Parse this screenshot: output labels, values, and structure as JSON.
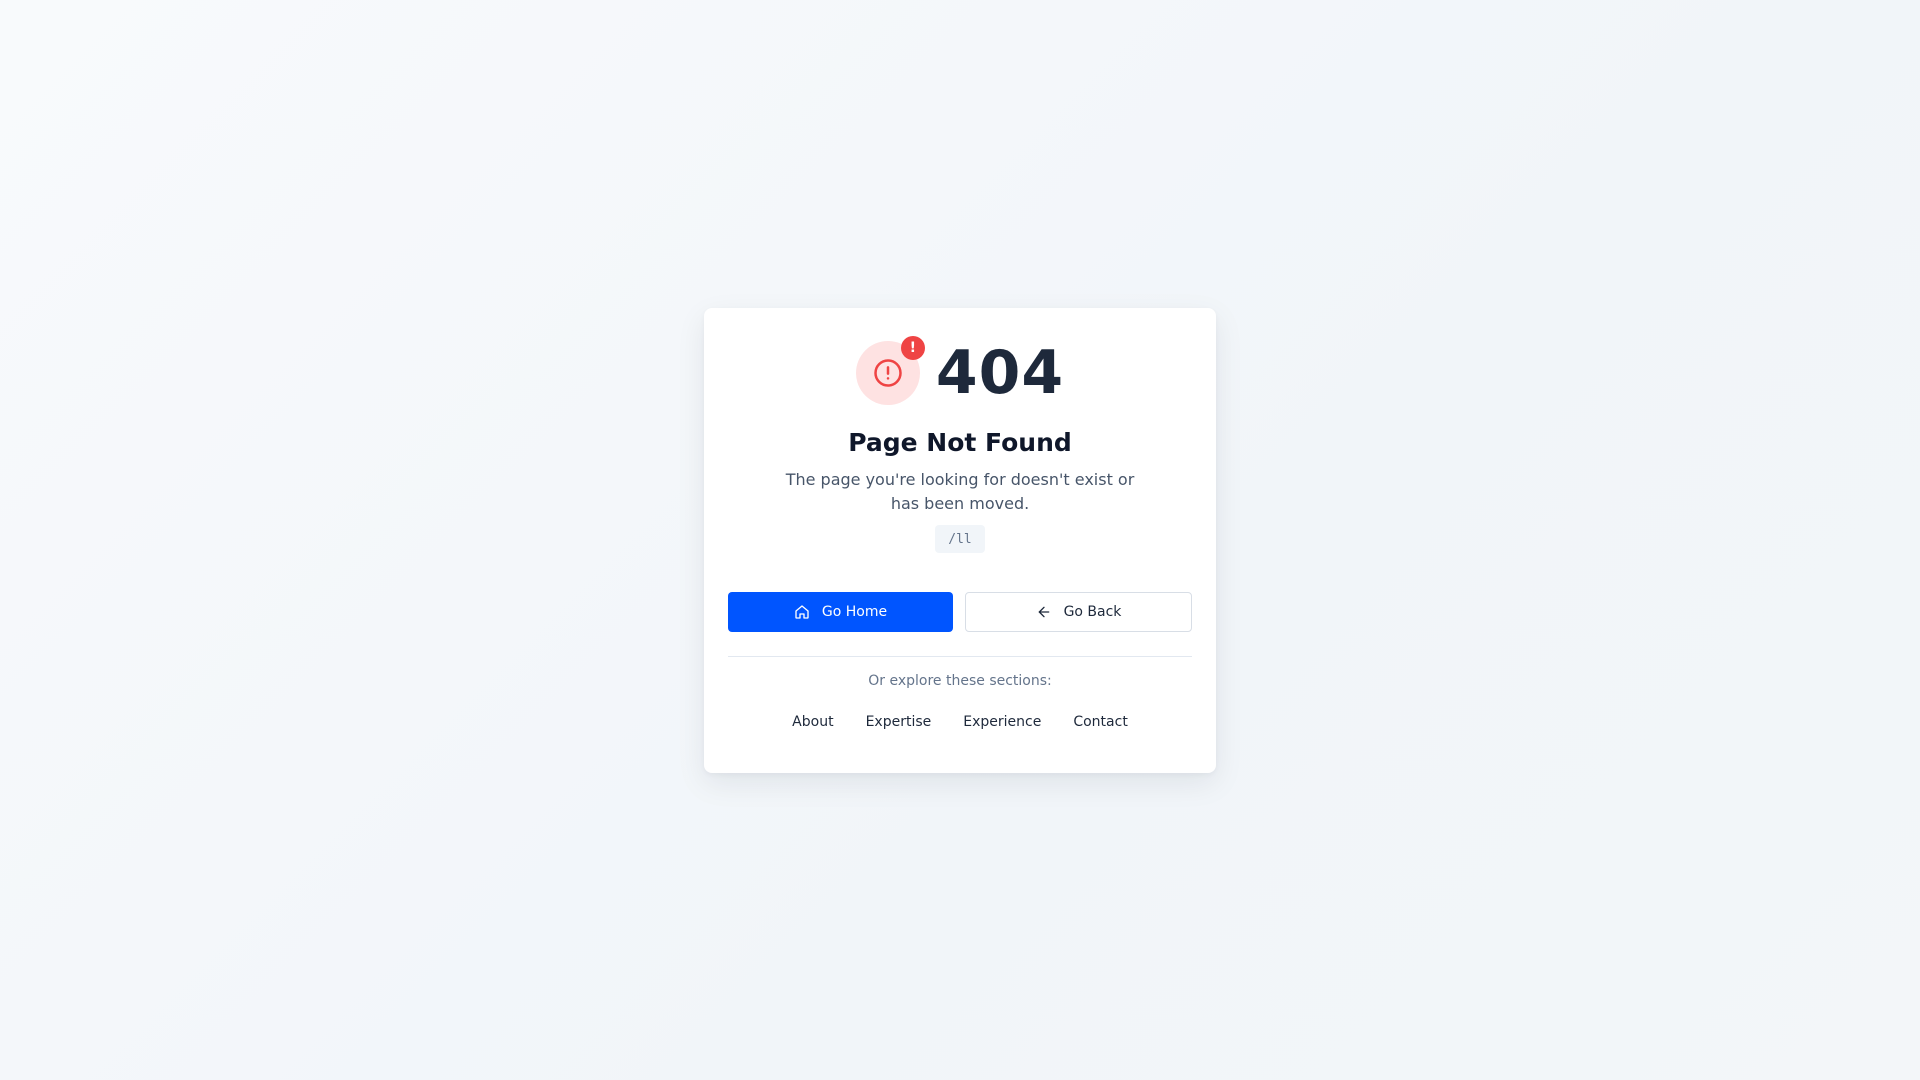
{
  "error": {
    "code": "404",
    "badge": "!",
    "title": "Page Not Found",
    "description": "The page you're looking for doesn't exist or has been moved.",
    "path": "/ll",
    "icon": "alert-circle-icon"
  },
  "actions": {
    "home_label": "Go Home",
    "home_icon": "home-icon",
    "back_label": "Go Back",
    "back_icon": "arrow-left-icon"
  },
  "explore": {
    "label": "Or explore these sections:",
    "links": [
      "About",
      "Expertise",
      "Experience",
      "Contact"
    ]
  },
  "colors": {
    "primary": "#0055ff",
    "danger": "#ef4444",
    "danger_soft": "#fee2e2",
    "heading": "#1e293b"
  }
}
